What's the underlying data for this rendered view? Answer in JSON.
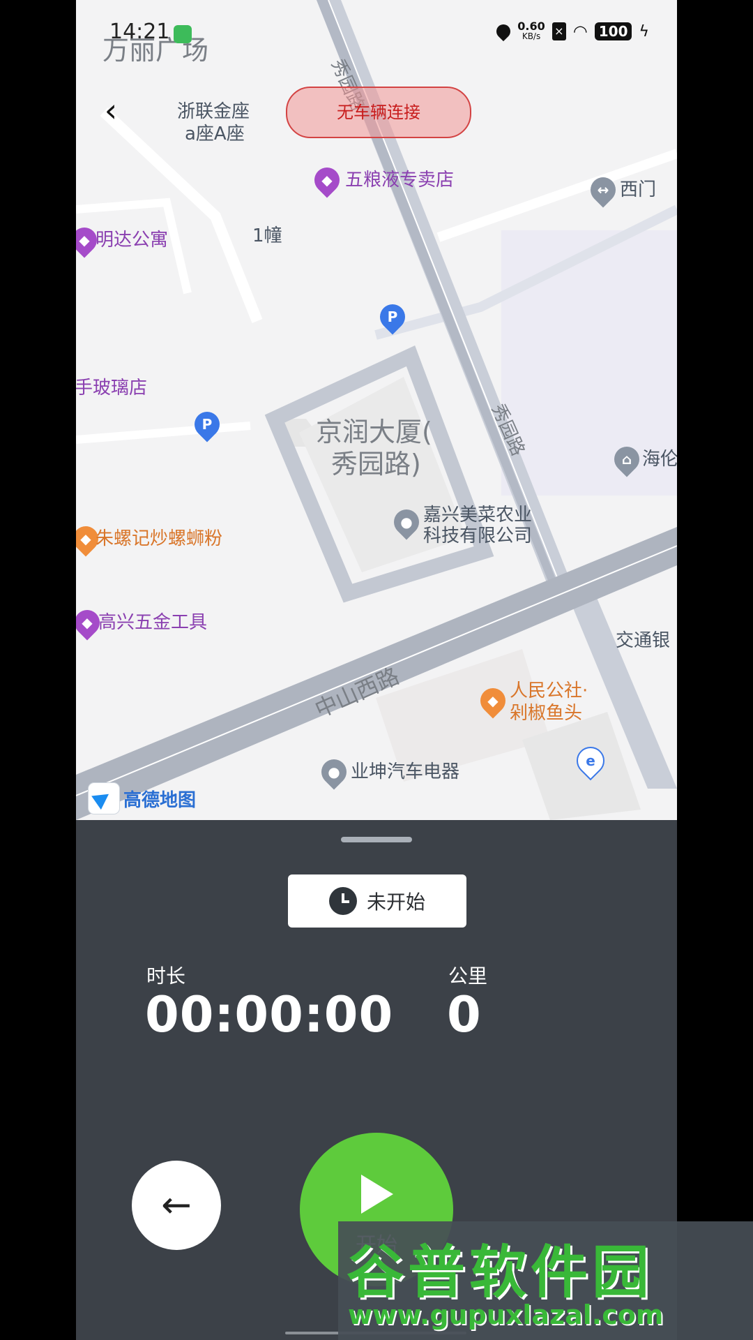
{
  "status_bar": {
    "time": "14:21",
    "net_speed_value": "0.60",
    "net_speed_unit": "KB/s",
    "battery": "100",
    "icons": [
      "wechat-icon",
      "location-icon",
      "sim-off-icon",
      "wifi-icon",
      "battery-icon",
      "charging-icon"
    ]
  },
  "top": {
    "back_icon": "chevron-left-icon",
    "vehicle_status": "无车辆连接"
  },
  "map": {
    "labels": {
      "wanli": "万丽广场",
      "zheliang": "浙联金座",
      "zheliang2": "a座A座",
      "wuliangye": "五粮液专卖店",
      "ximen": "西门",
      "mingda": "明达公寓",
      "building1": "1幢",
      "glass": "手玻璃店",
      "jingrun1": "京润大厦(",
      "jingrun2": "秀园路)",
      "xiuyuan_top": "秀园路",
      "xiuyuan_mid": "秀园路",
      "hailun": "海伦",
      "jiaxing1": "嘉兴美菜农业",
      "jiaxing2": "科技有限公司",
      "zhuluo": "朱螺记炒螺蛳粉",
      "gaoxing": "高兴五金工具",
      "jiaotong": "交通银",
      "zhongshan": "中山西路",
      "renmin1": "人民公社·",
      "renmin2": "剁椒鱼头",
      "yekun": "业坤汽车电器",
      "logo": "高德地图"
    }
  },
  "panel": {
    "status_chip": "未开始",
    "duration_label": "时长",
    "duration_value": "00:00:00",
    "distance_label": "公里",
    "distance_value": "0",
    "back_button_icon": "arrow-left-icon",
    "start_label": "开始"
  },
  "watermark": {
    "title": "谷普软件园",
    "url": "www.gupuxlazal.com"
  }
}
